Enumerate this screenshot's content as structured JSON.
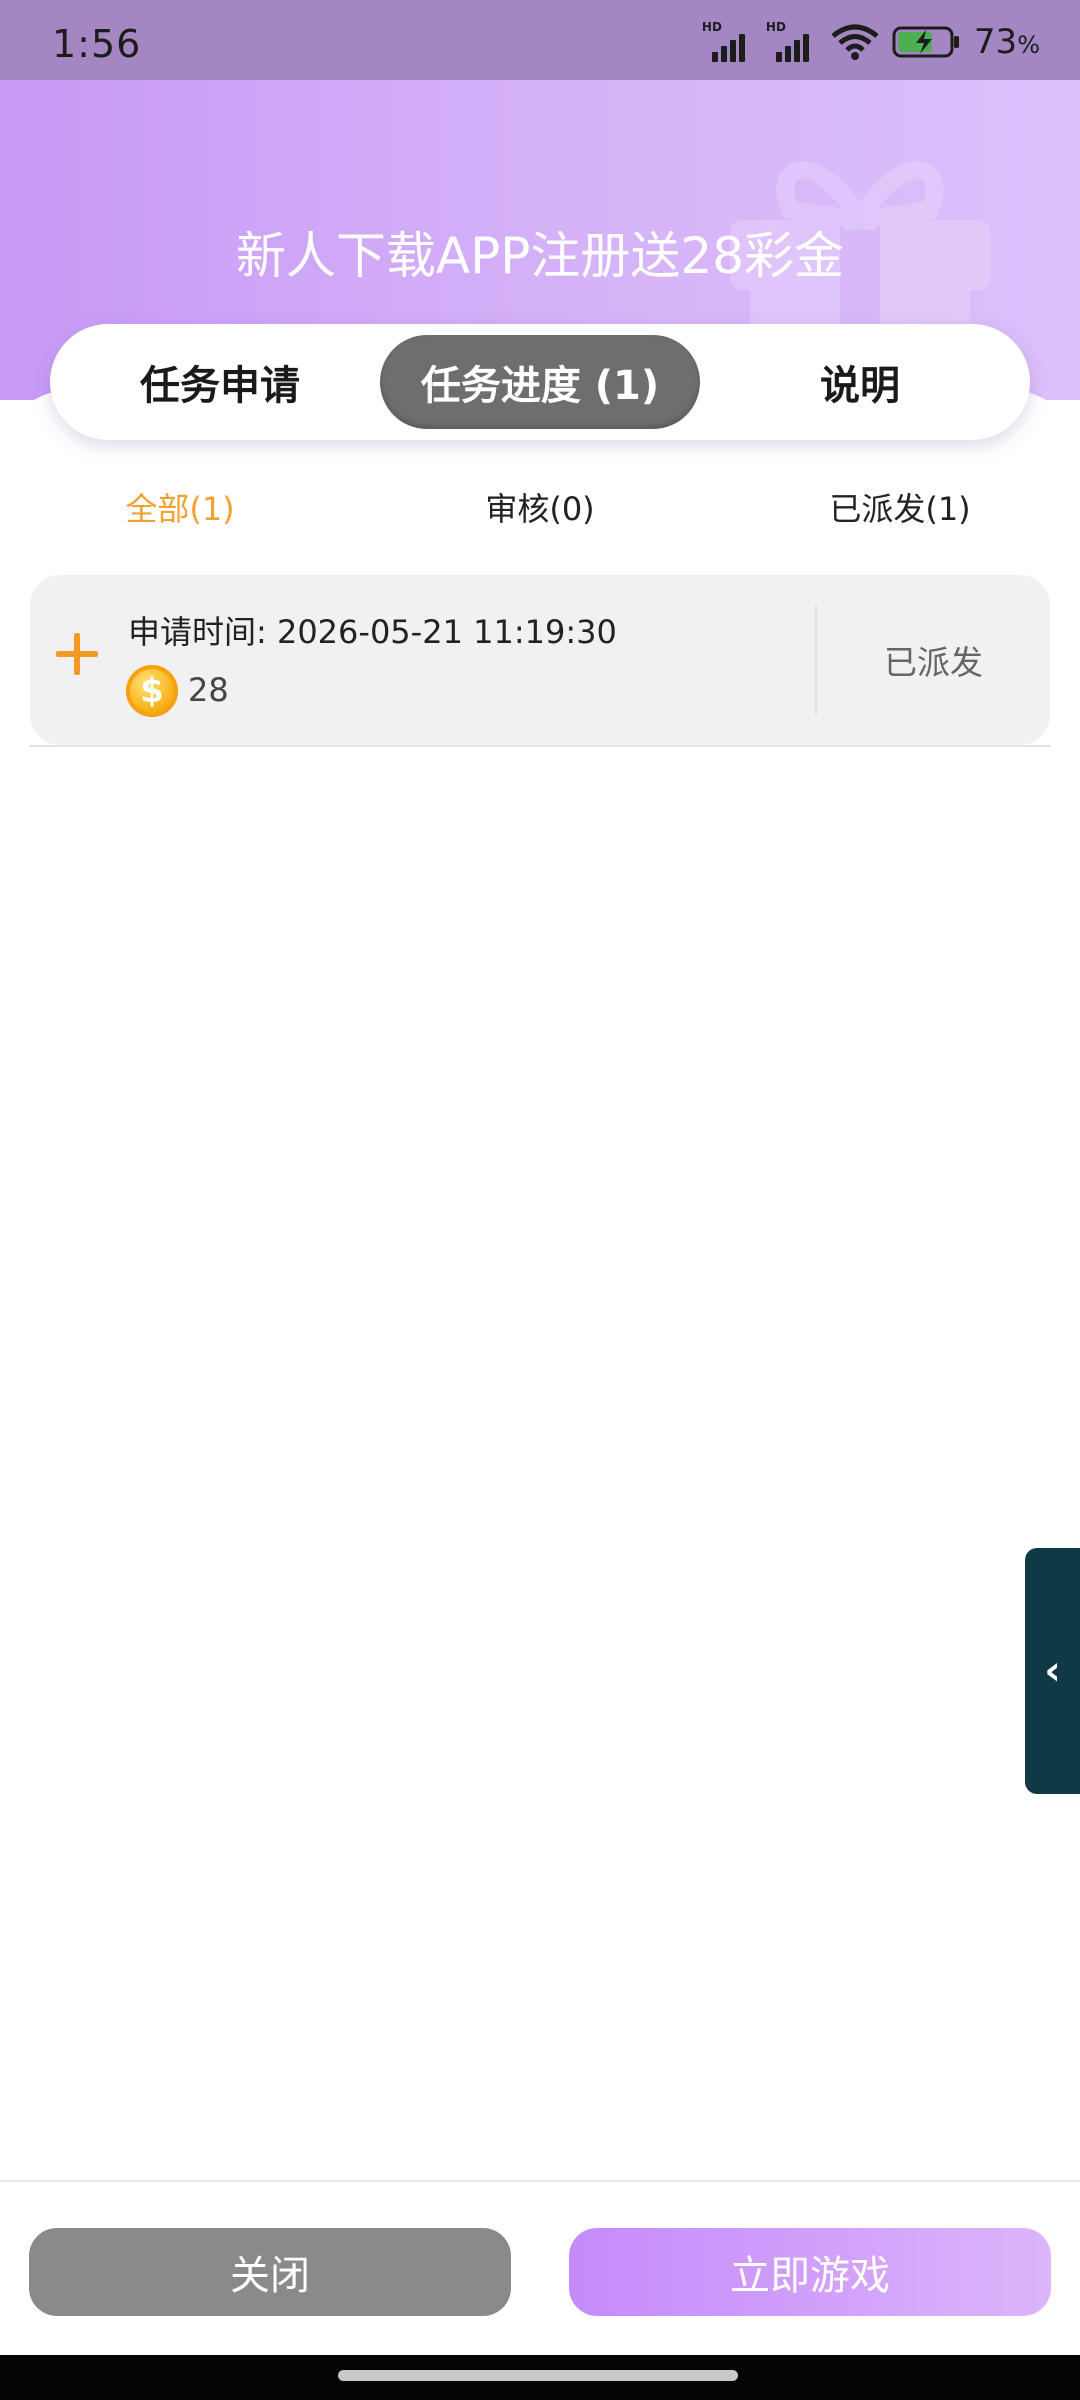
{
  "status_bar": {
    "time": "1:56",
    "network_1": "HD",
    "network_2": "HD",
    "battery_percent": "73",
    "battery_unit": "%"
  },
  "hero": {
    "title": "新人下载APP注册送28彩金"
  },
  "tabs": [
    {
      "label": "任务申请",
      "active": false
    },
    {
      "label": "任务进度 (1)",
      "active": true
    },
    {
      "label": "说明",
      "active": false
    }
  ],
  "filters": [
    {
      "label": "全部(1)",
      "active": true
    },
    {
      "label": "审核(0)",
      "active": false
    },
    {
      "label": "已派发(1)",
      "active": false
    }
  ],
  "records": [
    {
      "apply_time": "申请时间: 2026-05-21 11:19:30",
      "amount": "28",
      "status": "已派发"
    }
  ],
  "side_handle": {
    "icon": "chevron-left-icon",
    "glyph": "‹"
  },
  "bottom_bar": {
    "close_label": "关闭",
    "play_label": "立即游戏"
  },
  "colors": {
    "accent_orange": "#f2a033",
    "hero_purple": "#c79af6",
    "active_tab": "#6e6e6e",
    "handle": "#0f3944"
  }
}
